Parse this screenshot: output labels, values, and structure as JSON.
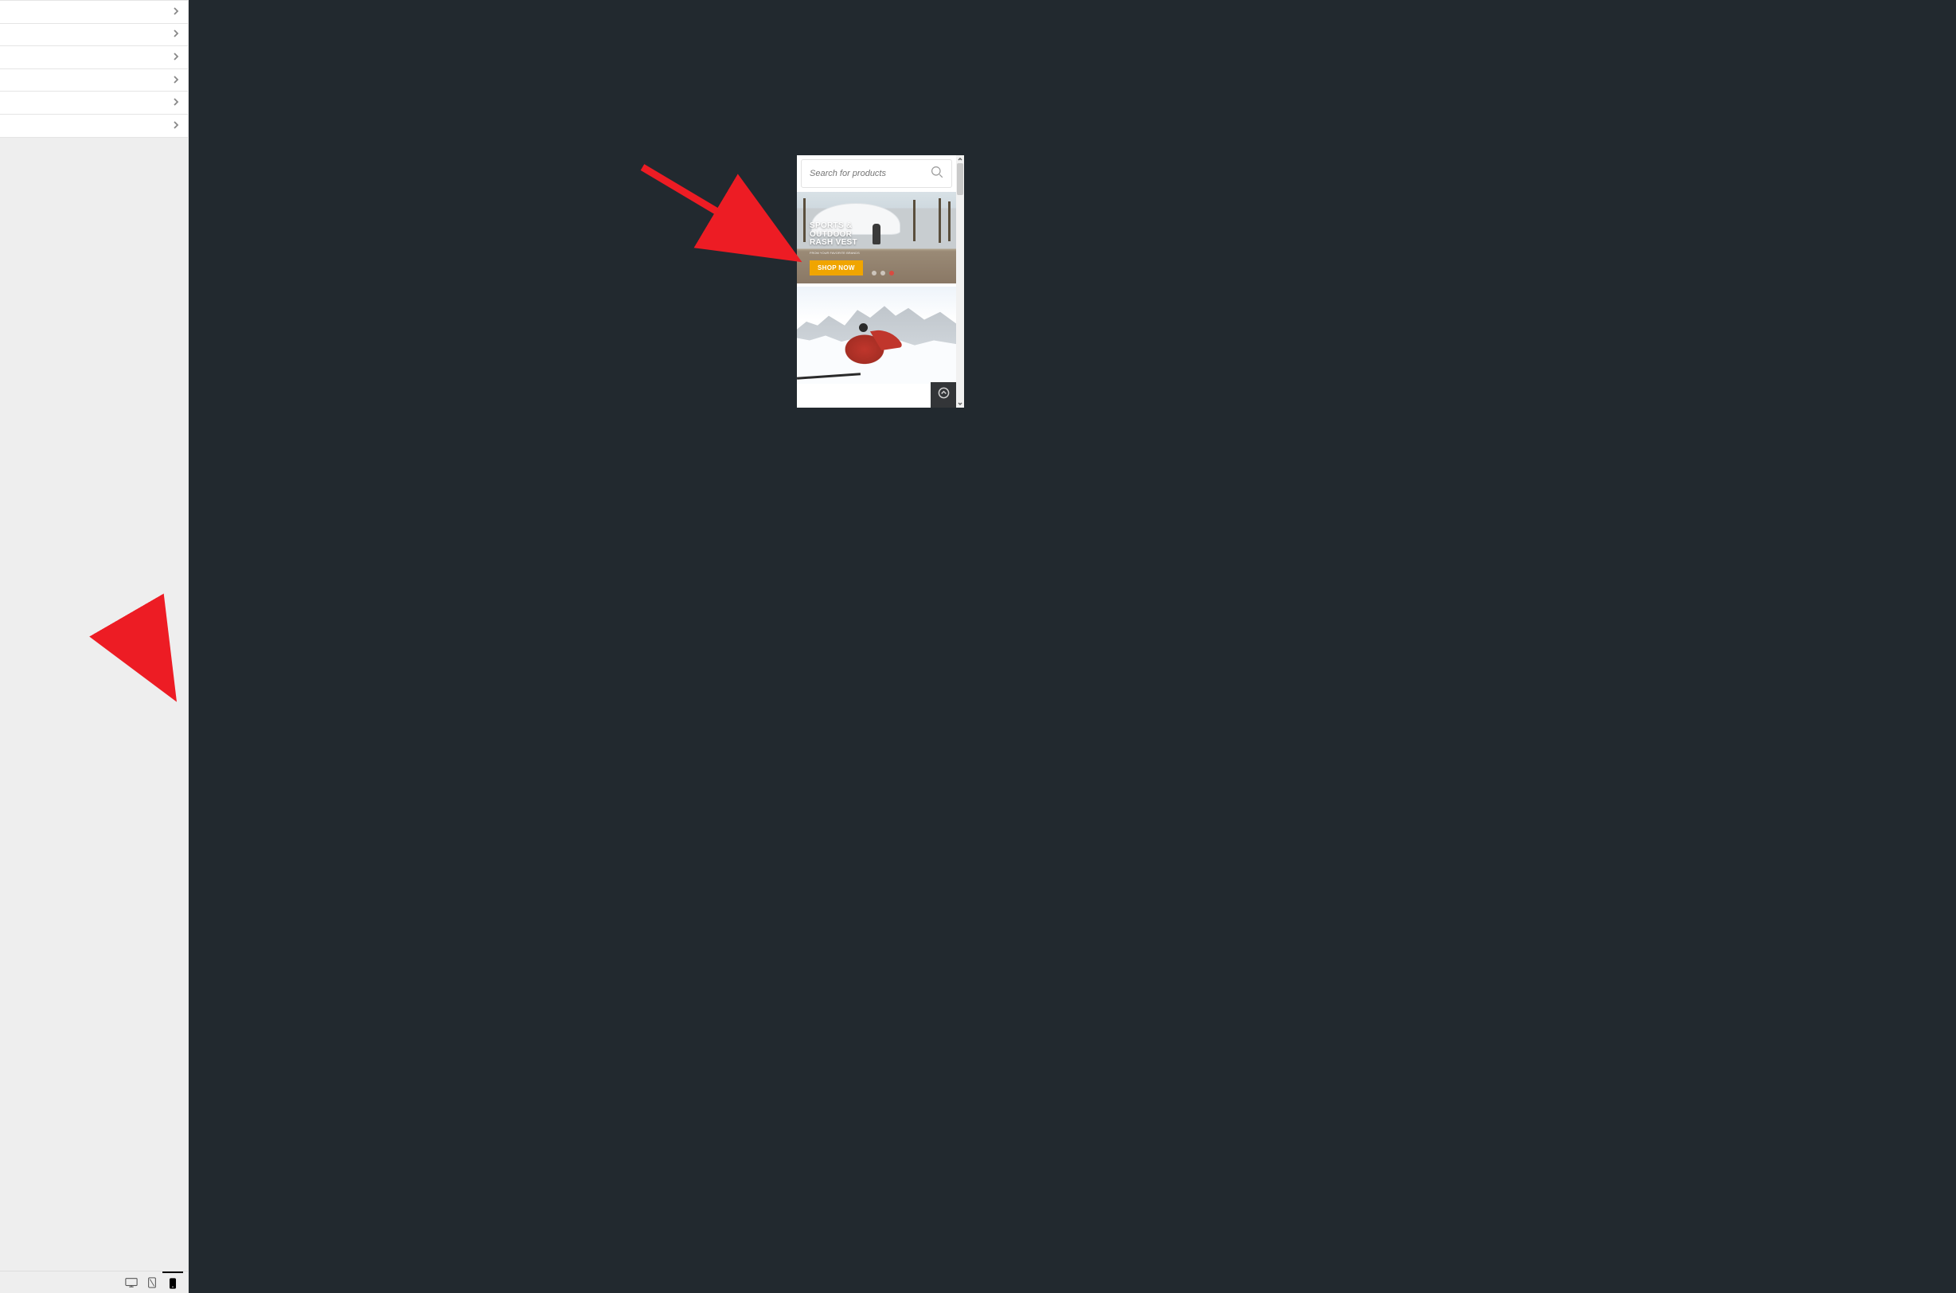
{
  "sidebar": {
    "items": [
      {
        "label": ""
      },
      {
        "label": ""
      },
      {
        "label": ""
      },
      {
        "label": ""
      },
      {
        "label": ""
      },
      {
        "label": ""
      }
    ]
  },
  "devices": {
    "desktop": "Desktop",
    "tablet": "Tablet",
    "mobile": "Mobile",
    "active": "mobile"
  },
  "preview": {
    "search_placeholder": "Search for products",
    "hero": {
      "line1": "SPORTS &",
      "line2": "OUTDOOR",
      "line3": "RASH VEST",
      "sub": "FROM YOUR FAVORITE BRANDS",
      "cta": "SHOP NOW",
      "dot_count": 3,
      "active_dot": 3
    }
  },
  "colors": {
    "canvas": "#22292f",
    "accent": "#f0a500",
    "arrow": "#ed1c24"
  }
}
